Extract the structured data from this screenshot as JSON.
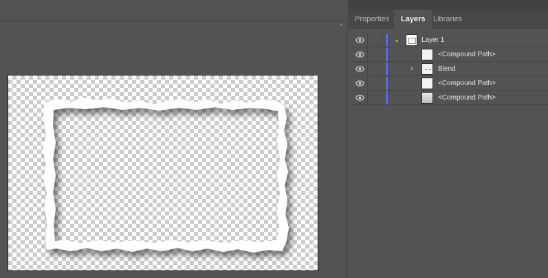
{
  "panel": {
    "tabs": [
      {
        "label": "Properties",
        "active": false
      },
      {
        "label": "Layers",
        "active": true
      },
      {
        "label": "Libraries",
        "active": false
      }
    ]
  },
  "layers": [
    {
      "name": "Layer 1",
      "visible": true,
      "expanded": true,
      "thumb": "layer",
      "has_toggle": true
    },
    {
      "name": "<Compound Path>",
      "visible": true,
      "thumb": "white"
    },
    {
      "name": "Blend",
      "visible": true,
      "expanded": false,
      "thumb": "blend",
      "has_toggle": true
    },
    {
      "name": "<Compound Path>",
      "visible": true,
      "thumb": "white"
    },
    {
      "name": "<Compound Path>",
      "visible": true,
      "thumb": "grey"
    }
  ],
  "icons": {
    "visibility": "eye-icon",
    "expand": "chevron-down-icon",
    "collapse": "chevron-right-icon",
    "scroll": "chevron-up-icon"
  },
  "colors": {
    "layer_color": "#4f6df5",
    "ui_background": "#535353",
    "tab_bar": "#474747"
  }
}
